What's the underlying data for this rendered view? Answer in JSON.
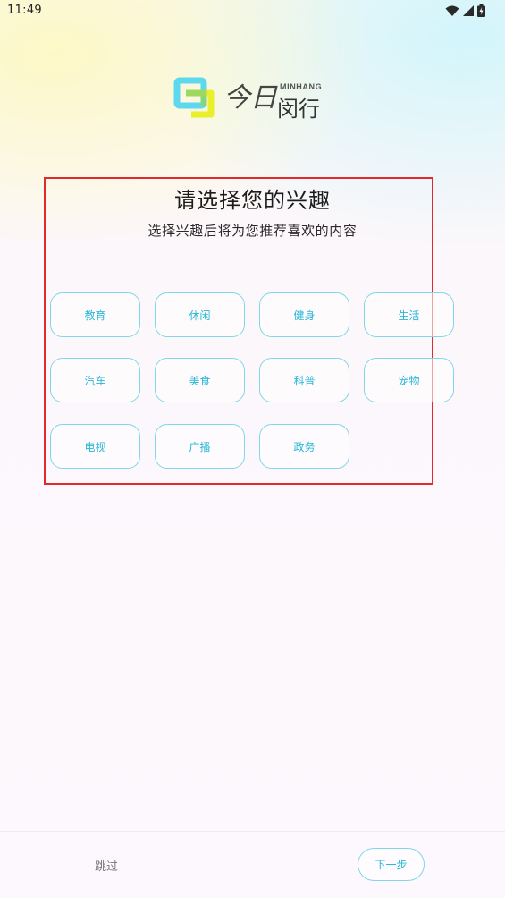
{
  "status_bar": {
    "time": "11:49",
    "icons": [
      "wifi-icon",
      "cell-signal-icon",
      "battery-icon"
    ]
  },
  "logo": {
    "cn_part1": "今日",
    "cn_part2": "闵行",
    "en": "MINHANG"
  },
  "header": {
    "title": "请选择您的兴趣",
    "subtitle": "选择兴趣后将为您推荐喜欢的内容"
  },
  "tags": [
    {
      "label": "教育"
    },
    {
      "label": "休闲"
    },
    {
      "label": "健身"
    },
    {
      "label": "生活"
    },
    {
      "label": "汽车"
    },
    {
      "label": "美食"
    },
    {
      "label": "科普"
    },
    {
      "label": "宠物"
    },
    {
      "label": "电视"
    },
    {
      "label": "广播"
    },
    {
      "label": "政务"
    }
  ],
  "footer": {
    "skip_label": "跳过",
    "next_label": "下一步"
  },
  "colors": {
    "accent": "#2ab7d9",
    "tag_border": "#7fd7e9",
    "highlight_border": "#e12b2b"
  }
}
